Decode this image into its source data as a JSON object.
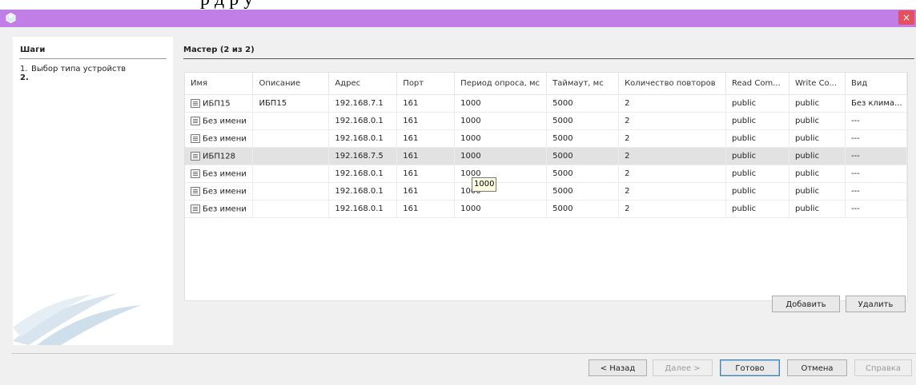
{
  "caption_fragment": "р                  д      р     у",
  "window": {
    "close_label": "×"
  },
  "steps": {
    "title": "Шаги",
    "items": [
      {
        "num": "1.",
        "label": "Выбор типа устройств"
      },
      {
        "num": "2.",
        "label": ""
      }
    ]
  },
  "wizard_title": "Мастер (2 из 2)",
  "table": {
    "columns": [
      "Имя",
      "Описание",
      "Адрес",
      "Порт",
      "Период опроса, мс",
      "Таймаут, мс",
      "Количество повторов",
      "Read Com...",
      "Write Co...",
      "Вид"
    ],
    "rows": [
      [
        "ИБП15",
        "ИБП15",
        "192.168.7.1",
        "161",
        "1000",
        "5000",
        "2",
        "public",
        "public",
        "Без клима..."
      ],
      [
        "Без имени",
        "",
        "192.168.0.1",
        "161",
        "1000",
        "5000",
        "2",
        "public",
        "public",
        "---"
      ],
      [
        "Без имени",
        "",
        "192.168.0.1",
        "161",
        "1000",
        "5000",
        "2",
        "public",
        "public",
        "---"
      ],
      [
        "ИБП128",
        "",
        "192.168.7.5",
        "161",
        "1000",
        "5000",
        "2",
        "public",
        "public",
        "---"
      ],
      [
        "Без имени",
        "",
        "192.168.0.1",
        "161",
        "1000",
        "5000",
        "2",
        "public",
        "public",
        "---"
      ],
      [
        "Без имени",
        "",
        "192.168.0.1",
        "161",
        "1000",
        "5000",
        "2",
        "public",
        "public",
        "---"
      ],
      [
        "Без имени",
        "",
        "192.168.0.1",
        "161",
        "1000",
        "5000",
        "2",
        "public",
        "public",
        "---"
      ]
    ],
    "selected_row": 3
  },
  "tooltip": "1000",
  "buttons": {
    "add": "Добавить",
    "remove": "Удалить",
    "back": "< Назад",
    "next": "Далее >",
    "finish": "Готово",
    "cancel": "Отмена",
    "help": "Справка"
  },
  "colors": {
    "titlebar": "#c07ee6",
    "close": "#e5505d",
    "selected_row": "#e2e2e2"
  }
}
